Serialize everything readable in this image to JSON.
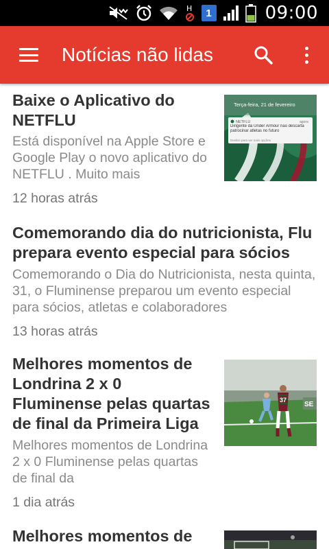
{
  "status_bar": {
    "time": "09:00",
    "notification_count": "1",
    "icons": [
      "mute-icon",
      "alarm-icon",
      "wifi-icon",
      "no-signal-icon",
      "notification-badge-icon",
      "signal-icon",
      "battery-icon"
    ]
  },
  "app_bar": {
    "title": "Notícias não lidas",
    "icons": [
      "menu-icon",
      "search-icon",
      "more-vert-icon"
    ],
    "color": "#e53b2f"
  },
  "news": [
    {
      "title": "Baixe o Aplicativo do NETFLU",
      "summary": "Está disponível na Apple Store e Google Play o novo aplicativo do NETFLU . Muito mais",
      "time": "12 horas atrás",
      "thumbnail": {
        "type": "phone-screenshot",
        "lock_text": "Terça-feira, 21 de fevereiro",
        "notif_app": "NETFLU",
        "notif_time": "agora",
        "notif_text": "Dirigente da Under Armour não descarta patrocinar atletas no futuro",
        "notif_sub": "Deslize para ver mais opções"
      }
    },
    {
      "title": "Comemorando dia do nutricionista, Flu prepara evento especial para sócios",
      "summary": "Comemorando o Dia do Nutricionista, nesta quinta, 31, o Fluminense preparou um evento especial para sócios, atletas e colaboradores",
      "time": "13 horas atrás"
    },
    {
      "title": "Melhores momentos de Londrina 2 x 0 Fluminense pelas quartas de final da Primeira Liga",
      "summary": "Melhores momentos de Londrina 2 x 0 Fluminense pelas quartas de final da",
      "time": "1 dia atrás",
      "thumbnail": {
        "type": "football-photo",
        "jersey_number": "37"
      }
    },
    {
      "title": "Melhores momentos de",
      "summary": "",
      "time": "",
      "thumbnail": {
        "type": "football-photo"
      }
    }
  ]
}
